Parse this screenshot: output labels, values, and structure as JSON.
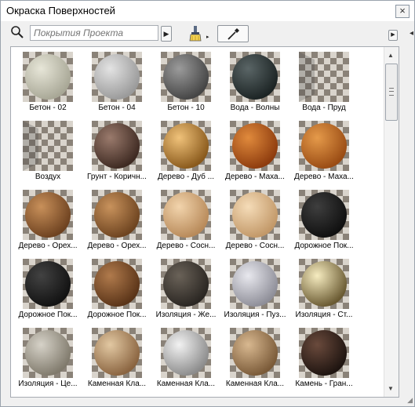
{
  "window": {
    "title": "Окраска Поверхностей",
    "close_glyph": "×"
  },
  "toolbar": {
    "search_placeholder": "Покрытия Проекта",
    "search_value": "",
    "icons": [
      "search-icon",
      "paint-brush-icon",
      "eyedropper-icon",
      "arrow-right-icon"
    ]
  },
  "materials": [
    {
      "label": "Бетон - 02",
      "kind": "sphere",
      "c1": "#e7e6d8",
      "c2": "#a8a796"
    },
    {
      "label": "Бетон - 04",
      "kind": "sphere",
      "c1": "#e3e3e3",
      "c2": "#9a9a9a"
    },
    {
      "label": "Бетон - 10",
      "kind": "sphere",
      "c1": "#9b9b9b",
      "c2": "#454545"
    },
    {
      "label": "Вода - Волны",
      "kind": "dark-sphere",
      "c1": "#5a6566",
      "c2": "#1c2424"
    },
    {
      "label": "Вода - Пруд",
      "kind": "checker-only",
      "c1": "#8c8c8c",
      "c2": "#c8c8c8"
    },
    {
      "label": "Воздух",
      "kind": "checker-only",
      "c1": "#8c8c8c",
      "c2": "#c8c8c8"
    },
    {
      "label": "Грунт - Коричн...",
      "kind": "sphere",
      "c1": "#9a7a6c",
      "c2": "#3e2a22"
    },
    {
      "label": "Дерево - Дуб ...",
      "kind": "sphere",
      "c1": "#f0c27a",
      "c2": "#8a5a1c"
    },
    {
      "label": "Дерево - Маха...",
      "kind": "sphere",
      "c1": "#e08a3c",
      "c2": "#8e3c0e"
    },
    {
      "label": "Дерево - Маха...",
      "kind": "sphere",
      "c1": "#e59a4a",
      "c2": "#9a4c14"
    },
    {
      "label": "Дерево - Орех...",
      "kind": "sphere",
      "c1": "#c8905a",
      "c2": "#6e4220"
    },
    {
      "label": "Дерево - Орех...",
      "kind": "sphere",
      "c1": "#c8925c",
      "c2": "#6e4420"
    },
    {
      "label": "Дерево - Сосн...",
      "kind": "sphere",
      "c1": "#f2d4ac",
      "c2": "#b88a5a"
    },
    {
      "label": "Дерево - Сосн...",
      "kind": "sphere",
      "c1": "#f5dcb8",
      "c2": "#c29868"
    },
    {
      "label": "Дорожное Пок...",
      "kind": "sphere",
      "c1": "#3e3e3e",
      "c2": "#101010"
    },
    {
      "label": "Дорожное Пок...",
      "kind": "sphere",
      "c1": "#424242",
      "c2": "#121212"
    },
    {
      "label": "Дорожное Пок...",
      "kind": "sphere",
      "c1": "#b07a4c",
      "c2": "#5a3418"
    },
    {
      "label": "Изоляция - Же...",
      "kind": "sphere",
      "c1": "#6a6258",
      "c2": "#2a2622"
    },
    {
      "label": "Изоляция - Пуз...",
      "kind": "sphere",
      "c1": "#e8e8ee",
      "c2": "#8e8e98"
    },
    {
      "label": "Изоляция - Ст...",
      "kind": "sphere",
      "c1": "#f6ecc0",
      "c2": "#6a5a32"
    },
    {
      "label": "Изоляция - Це...",
      "kind": "sphere",
      "c1": "#d6d2c8",
      "c2": "#807a6c"
    },
    {
      "label": "Каменная Кла...",
      "kind": "sphere",
      "c1": "#e2c8a2",
      "c2": "#8a6440"
    },
    {
      "label": "Каменная Кла...",
      "kind": "sphere",
      "c1": "#f2f2f2",
      "c2": "#8c8c8c"
    },
    {
      "label": "Каменная Кла...",
      "kind": "sphere",
      "c1": "#d8b890",
      "c2": "#7a5a38"
    },
    {
      "label": "Камень - Гран...",
      "kind": "sphere",
      "c1": "#6a4a3c",
      "c2": "#1e1410"
    }
  ],
  "scroll": {
    "position": 0.0
  }
}
